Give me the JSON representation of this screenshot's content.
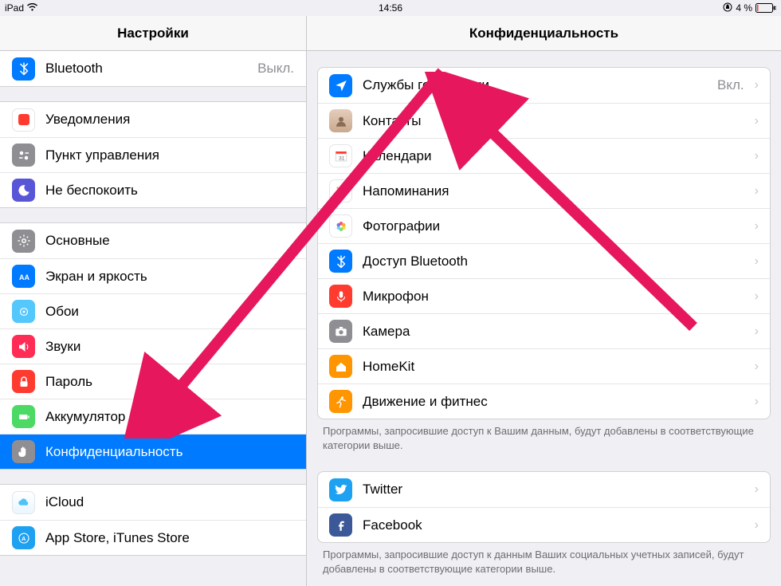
{
  "statusbar": {
    "device": "iPad",
    "time": "14:56",
    "battery": "4 %"
  },
  "left": {
    "title": "Настройки",
    "groups": [
      {
        "rows": [
          {
            "id": "bluetooth",
            "label": "Bluetooth",
            "value": "Выкл.",
            "icon": "#007aff"
          }
        ]
      },
      {
        "rows": [
          {
            "id": "notifications",
            "label": "Уведомления",
            "icon": "#ff3b30"
          },
          {
            "id": "controlcenter",
            "label": "Пункт управления",
            "icon": "#8e8e93"
          },
          {
            "id": "dnd",
            "label": "Не беспокоить",
            "icon": "#5856d6"
          }
        ]
      },
      {
        "rows": [
          {
            "id": "general",
            "label": "Основные",
            "icon": "#8e8e93"
          },
          {
            "id": "display",
            "label": "Экран и яркость",
            "icon": "#007aff"
          },
          {
            "id": "wallpaper",
            "label": "Обои",
            "icon": "#54c7fc"
          },
          {
            "id": "sounds",
            "label": "Звуки",
            "icon": "#ff2d55"
          },
          {
            "id": "passcode",
            "label": "Пароль",
            "icon": "#ff3b30"
          },
          {
            "id": "battery",
            "label": "Аккумулятор",
            "icon": "#4cd964"
          },
          {
            "id": "privacy",
            "label": "Конфиденциальность",
            "icon": "#8e8e93",
            "selected": true
          }
        ]
      },
      {
        "rows": [
          {
            "id": "icloud",
            "label": "iCloud",
            "icon": "#ffffff"
          },
          {
            "id": "appstore",
            "label": "App Store, iTunes Store",
            "icon": "#1ea1f1"
          }
        ]
      }
    ]
  },
  "right": {
    "title": "Конфиденциальность",
    "groups": [
      {
        "rows": [
          {
            "id": "location",
            "label": "Службы геолокации",
            "value": "Вкл.",
            "icon": "#007aff"
          },
          {
            "id": "contacts",
            "label": "Контакты",
            "icon": "#d7b9a5"
          },
          {
            "id": "calendars",
            "label": "Календари",
            "icon": "#ffffff"
          },
          {
            "id": "reminders",
            "label": "Напоминания",
            "icon": "#ffffff"
          },
          {
            "id": "photos",
            "label": "Фотографии",
            "icon": "#ffffff"
          },
          {
            "id": "bluetooth-sharing",
            "label": "Доступ Bluetooth",
            "icon": "#007aff"
          },
          {
            "id": "microphone",
            "label": "Микрофон",
            "icon": "#ff3b30"
          },
          {
            "id": "camera",
            "label": "Камера",
            "icon": "#8e8e93"
          },
          {
            "id": "homekit",
            "label": "HomeKit",
            "icon": "#ff9500"
          },
          {
            "id": "motion",
            "label": "Движение и фитнес",
            "icon": "#ff9500"
          }
        ],
        "footer": "Программы, запросившие доступ к Вашим данным, будут добавлены в соответствующие категории выше."
      },
      {
        "rows": [
          {
            "id": "twitter",
            "label": "Twitter",
            "icon": "#1da1f2"
          },
          {
            "id": "facebook",
            "label": "Facebook",
            "icon": "#3b5998"
          }
        ],
        "footer": "Программы, запросившие доступ к данным Ваших социальных учетных записей, будут добавлены в соответствующие категории выше."
      }
    ]
  }
}
